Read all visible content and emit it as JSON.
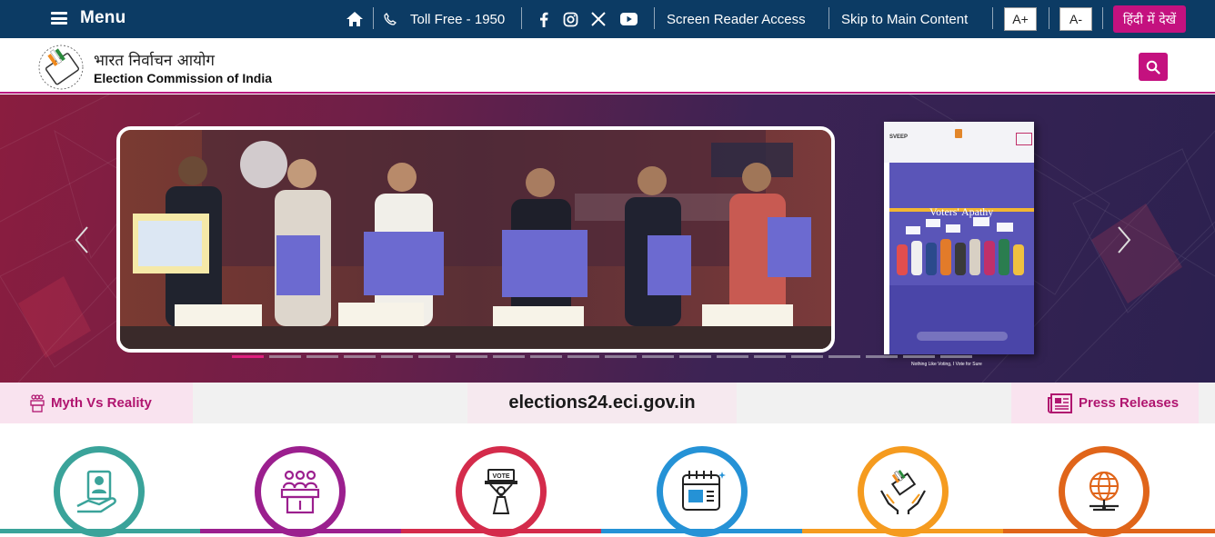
{
  "topbar": {
    "menu_label": "Menu",
    "toll_free": "Toll Free - 1950",
    "screen_reader": "Screen Reader Access",
    "skip_main": "Skip to Main Content",
    "font_increase": "A+",
    "font_decrease": "A-",
    "hindi_toggle": "हिंदी में देखें",
    "social_icons": [
      "facebook-icon",
      "instagram-icon",
      "x-icon",
      "youtube-icon"
    ]
  },
  "header": {
    "logo_hindi": "भारत निर्वाचन आयोग",
    "logo_english": "Election Commission of India"
  },
  "hero": {
    "book_brand": "SVEEP",
    "book_title": "Voters' Apathy",
    "book_tagline": "Nothing Like Voting, I Vote for Sure",
    "slide_count": 20,
    "active_slide": 1,
    "accent_color": "#e0207f"
  },
  "strip": {
    "left_label": "Myth Vs Reality",
    "center_label": "elections24.eci.gov.in",
    "right_label": "Press Releases"
  },
  "services": [
    {
      "icon": "voter-services-icon",
      "color": "#3aa39a"
    },
    {
      "icon": "candidate-icon",
      "color": "#9b1f8e"
    },
    {
      "icon": "vote-icon",
      "color": "#d42b4b"
    },
    {
      "icon": "calendar-icon",
      "color": "#2592d6"
    },
    {
      "icon": "evm-care-icon",
      "color": "#f59b1f"
    },
    {
      "icon": "globe-icon",
      "color": "#e0651a"
    }
  ],
  "colors": {
    "topbar_bg": "#0c3b64",
    "brand_pink": "#c4117f"
  }
}
